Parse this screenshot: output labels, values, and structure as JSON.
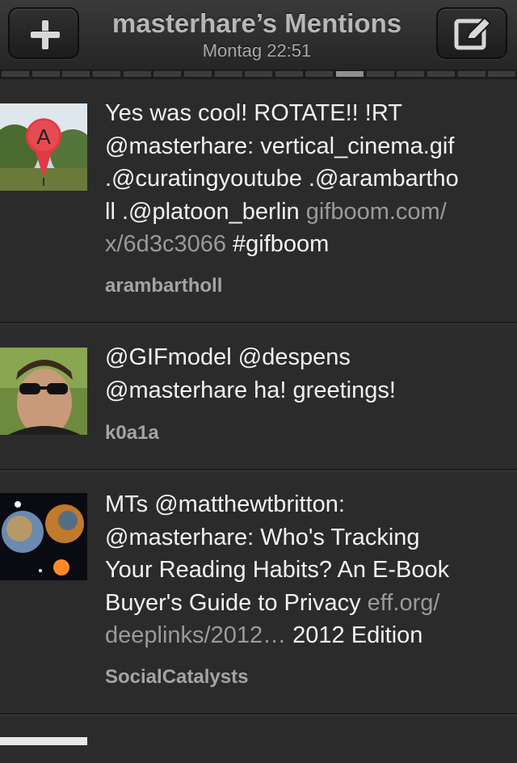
{
  "header": {
    "title": "masterhare’s Mentions",
    "subtitle": "Montag 22:51",
    "left_button_icon": "plus-icon",
    "right_button_icon": "compose-icon"
  },
  "pager": {
    "count": 17,
    "active_index": 11
  },
  "tweets": [
    {
      "lines": [
        [
          {
            "t": "Yes was cool! ROTATE!! !RT"
          }
        ],
        [
          {
            "t": "@masterhare: vertical_cinema.gif"
          }
        ],
        [
          {
            "t": ".@curatingyoutube .@arambartho"
          }
        ],
        [
          {
            "t": "ll .@platoon_berlin "
          },
          {
            "t": "gifboom.com/",
            "link": true
          }
        ],
        [
          {
            "t": "x/6d3c3066",
            "link": true
          },
          {
            "t": " #gifboom"
          }
        ]
      ],
      "username": "arambartholl",
      "avatar": "map-pin-balloon-avatar"
    },
    {
      "lines": [
        [
          {
            "t": "@GIFmodel @despens"
          }
        ],
        [
          {
            "t": "@masterhare ha! greetings!"
          }
        ]
      ],
      "username": "k0a1a",
      "avatar": "man-sunglasses-avatar"
    },
    {
      "lines": [
        [
          {
            "t": "MTs @matthewtbritton:"
          }
        ],
        [
          {
            "t": "@masterhare: Who's Tracking"
          }
        ],
        [
          {
            "t": "Your Reading Habits? An E-Book"
          }
        ],
        [
          {
            "t": "Buyer's Guide to Privacy "
          },
          {
            "t": "eff.org/",
            "link": true
          }
        ],
        [
          {
            "t": "deeplinks/2012…",
            "link": true
          },
          {
            "t": " 2012 Edition"
          }
        ]
      ],
      "username": "SocialCatalysts",
      "avatar": "planets-avatar"
    }
  ],
  "colors": {
    "background": "#2b2b2c",
    "text": "#f2f2f2",
    "link": "#9a9a9b",
    "username": "#a4a4a5"
  }
}
